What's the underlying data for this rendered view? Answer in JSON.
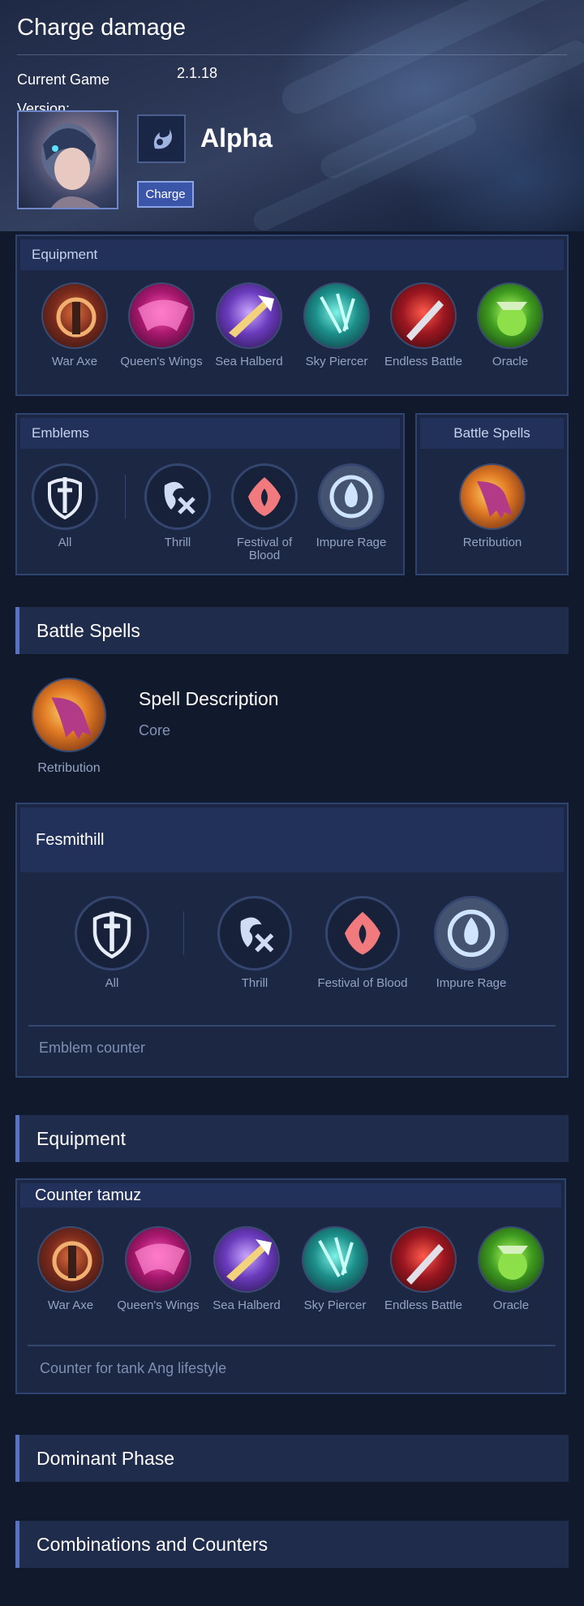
{
  "hero": {
    "page_title": "Charge damage",
    "version_label": "Current Game Version:",
    "version_value": "2.1.18",
    "name": "Alpha",
    "tag": "Charge"
  },
  "equipment_panel": {
    "title": "Equipment",
    "items": [
      {
        "label": "War Axe",
        "icon": "war-axe-icon"
      },
      {
        "label": "Queen's Wings",
        "icon": "queens-wings-icon"
      },
      {
        "label": "Sea Halberd",
        "icon": "sea-halberd-icon"
      },
      {
        "label": "Sky Piercer",
        "icon": "sky-piercer-icon"
      },
      {
        "label": "Endless Battle",
        "icon": "endless-battle-icon"
      },
      {
        "label": "Oracle",
        "icon": "oracle-icon"
      }
    ]
  },
  "emblems_panel": {
    "title": "Emblems",
    "main": "All",
    "talents": [
      "Thrill",
      "Festival of Blood",
      "Impure Rage"
    ]
  },
  "spells_panel": {
    "title": "Battle Spells",
    "spell": "Retribution"
  },
  "battle_spells_section": {
    "title": "Battle Spells",
    "spell": "Retribution",
    "desc_title": "Spell Description",
    "desc_sub": "Core"
  },
  "emblem_build": {
    "title": "Fesmithill",
    "main": "All",
    "talents": [
      "Thrill",
      "Festival of Blood",
      "Impure Rage"
    ],
    "note": "Emblem counter"
  },
  "equipment_section": {
    "title": "Equipment",
    "build_title": "Counter tamuz",
    "items": [
      "War Axe",
      "Queen's Wings",
      "Sea Halberd",
      "Sky Piercer",
      "Endless Battle",
      "Oracle"
    ],
    "note": "Counter for tank Ang lifestyle"
  },
  "sections": {
    "dominant": "Dominant Phase",
    "combos": "Combinations and Counters"
  },
  "colors": {
    "background": "#111a2c",
    "panel": "#1b2743",
    "accent": "#5673c4"
  }
}
